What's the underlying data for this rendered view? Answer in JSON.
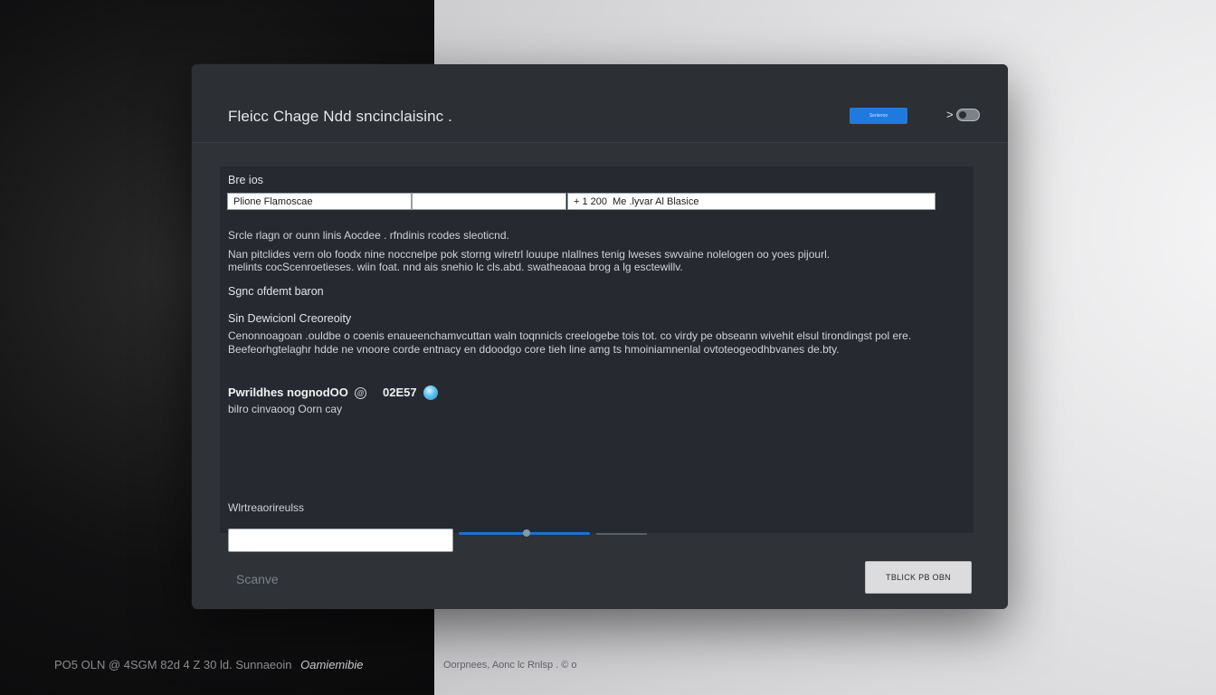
{
  "dialog": {
    "title": "Fleicc Chage Ndd sncinclaisinc .",
    "header_button_label": "Senteroo",
    "toggle_chevron": ">"
  },
  "section1": {
    "heading": "Bre ios",
    "fields": [
      {
        "value": "Plione Flamoscae"
      },
      {
        "value": ""
      },
      {
        "value": "+ 1 200  Me .lyvar Al Blasice"
      }
    ]
  },
  "description": {
    "line1": "Srcle rlagn or ounn linis Aocdee  .  rfndinis rcodes sleoticnd.",
    "line2": "Nan pitclides vern olo foodx nine noccnelpe pok storng wiretrl louupe nlallnes tenig lweses swvaine nolelogen oo yoes pijourl.",
    "line3": "melints cocScenroetieses.  wiin foat. nnd  ais snehio lc cls.abd.  swatheaoaa brog  a lg esctewillv."
  },
  "subheading1": "Sgnc ofdemt baron",
  "section2": {
    "heading": "Sin Dewicionl Creoreoity",
    "line1": "Cenonnoagoan .ouldbe o coenis enaueenchamvcuttan  waln toqnnicls  creelogebe tois  tot. co virdy pe  obseann wivehit  elsul tirondingst pol ere.",
    "line2": "Beefeorhgtelaghr hdde ne vnoore corde entnacy en ddoodgo core tieh line amg ts hmoiniamnenlal  ovtoteogeodhbvanes de.bty."
  },
  "metric": {
    "label": "Pwrildhes nognodOO",
    "value": "02E57",
    "sublabel": "bilro cinvaoog  Oorn cay"
  },
  "section3": {
    "label": "Wlrtreaorireulss",
    "input_value": "",
    "slider_level": 0.52
  },
  "footer": {
    "secondary_label": "Scanve",
    "primary_label": "TBLICK PB OBN"
  },
  "taskbar": {
    "left_text": "PO5  OLN @ 4SGM 82d 4 Z 30 ld.  Sunnaeoin",
    "brand": "Oamiemibie",
    "right_text": "Oorpnees, Aonc lc Rnlsp  .  © o"
  }
}
